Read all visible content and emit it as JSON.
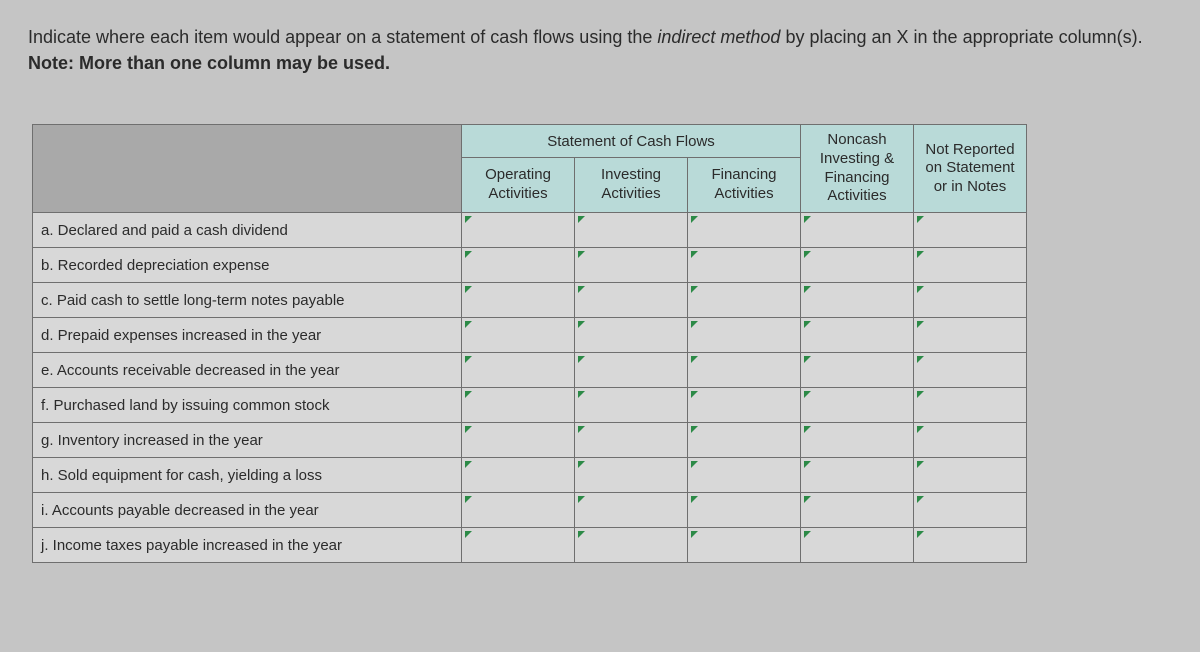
{
  "instructions": {
    "line1a": "Indicate where each item would appear on a statement of cash flows using the ",
    "line1b": "indirect method",
    "line1c": " by placing an X in the appropriate column(s).",
    "note_prefix": "Note: ",
    "note_body": "More than one column may be used."
  },
  "headers": {
    "stmt_span": "Statement of Cash Flows",
    "operating": "Operating Activities",
    "investing": "Investing Activities",
    "financing": "Financing Activities",
    "noncash": "Noncash Investing & Financing Activities",
    "not_reported": "Not Reported on Statement or in Notes"
  },
  "rows": [
    {
      "label": "a. Declared and paid a cash dividend"
    },
    {
      "label": "b. Recorded depreciation expense"
    },
    {
      "label": "c. Paid cash to settle long-term notes payable"
    },
    {
      "label": "d. Prepaid expenses increased in the year"
    },
    {
      "label": "e. Accounts receivable decreased in the year"
    },
    {
      "label": "f. Purchased land by issuing common stock"
    },
    {
      "label": "g. Inventory increased in the year"
    },
    {
      "label": "h. Sold equipment for cash, yielding a loss"
    },
    {
      "label": "i. Accounts payable decreased in the year"
    },
    {
      "label": "j. Income taxes payable increased in the year"
    }
  ]
}
